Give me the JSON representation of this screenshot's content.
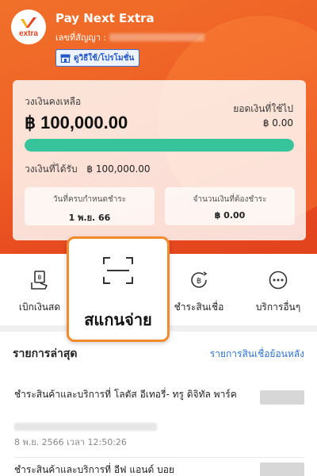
{
  "header": {
    "app_title": "Pay Next Extra",
    "contract_label": "เลขที่สัญญา :",
    "promo_button": "ดูวิธีใช้/โปรโมชั่น",
    "logo_text": "extra"
  },
  "balance": {
    "remaining_label": "วงเงินคงเหลือ",
    "remaining_amount": "฿ 100,000.00",
    "used_label": "ยอดเงินที่ใช้ไป",
    "used_amount": "฿ 0.00",
    "remaining_fraction": 1.0,
    "credit_label": "วงเงินที่ได้รับ",
    "credit_amount": "฿ 100,000.00",
    "due_date_label": "วันที่ครบกำหนดชำระ",
    "due_date": "1 พ.ย. 66",
    "amount_due_label": "จำนวนเงินที่ต้องชำระ",
    "amount_due": "฿ 0.00"
  },
  "actions": {
    "withdraw": "เบิกเงินสด",
    "scan_pay": "สแกนจ่าย",
    "pay_product": "ชำระสินเชื่อ",
    "other": "บริการอื่นๆ"
  },
  "recent": {
    "title": "รายการล่าสุด",
    "history_link": "รายการสินเชื่อย้อนหลัง",
    "items": [
      {
        "description": "ชำระสินค้าและบริการที่ โลตัส อีเทอรี่- ทรู ดิจิทัล พาร์ค",
        "time": "8 พ.ย. 2566 เวลา 12:50:26"
      },
      {
        "description": "ชำระสินค้าและบริการที่ อีฟ แอนด์ บอย"
      }
    ]
  },
  "colors": {
    "header": "#ef6226",
    "progress": "#37c49a",
    "accent_blue": "#2e73d1",
    "scan_border": "#f28a2e"
  }
}
